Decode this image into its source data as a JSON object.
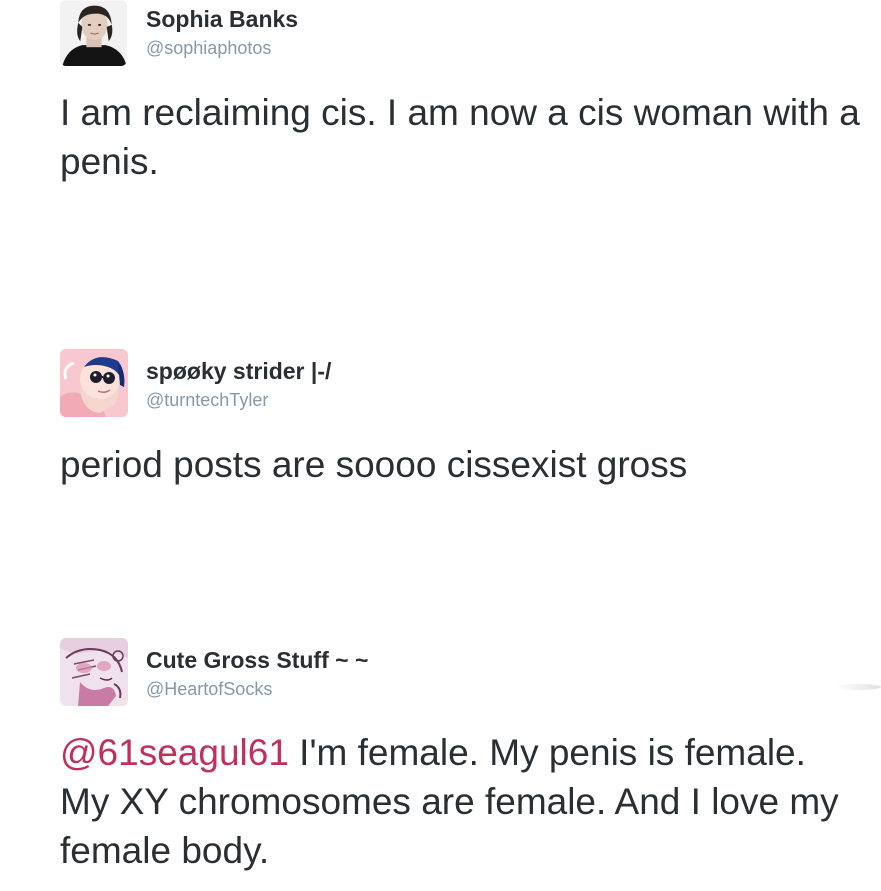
{
  "tweets": [
    {
      "display_name": "Sophia Banks",
      "handle": "@sophiaphotos",
      "avatar_icon": "profile-photo-icon",
      "text": "I am reclaiming cis. I am now a cis woman with a penis.",
      "mention": ""
    },
    {
      "display_name": "spøøky strider |-/",
      "handle": "@turntechTyler",
      "avatar_icon": "cartoon-avatar-icon",
      "text": "period posts are soooo cissexist gross",
      "mention": ""
    },
    {
      "display_name": "Cute Gross Stuff ~ ~",
      "handle": "@HeartofSocks",
      "avatar_icon": "drawn-avatar-icon",
      "mention": "@61seagul61",
      "text": " I'm female. My penis is female. My XY chromosomes are female. And I love my female body."
    }
  ],
  "colors": {
    "text": "#292f33",
    "handle": "#8899a6",
    "mention": "#c1305a"
  }
}
